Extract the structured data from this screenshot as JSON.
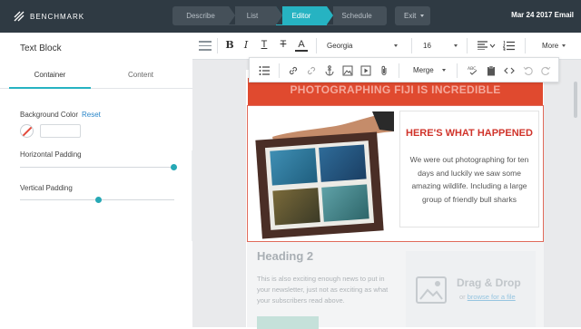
{
  "topbar": {
    "brand": "BENCHMARK",
    "steps": [
      "Describe",
      "List",
      "Editor",
      "Schedule"
    ],
    "active_step": "Editor",
    "exit_label": "Exit",
    "date_title": "Mar 24 2017 Email",
    "accent": "#26b3c2"
  },
  "left_panel": {
    "title": "Text Block",
    "tabs": [
      "Container",
      "Content"
    ],
    "active_tab": "Container",
    "background_color_label": "Background Color",
    "reset_label": "Reset",
    "horizontal_padding_label": "Horizontal Padding",
    "horizontal_padding_level": 1.0,
    "vertical_padding_label": "Vertical Padding",
    "vertical_padding_level": 0.5
  },
  "toolbar": {
    "bold": "B",
    "italic": "I",
    "underline": "T",
    "strike": "T",
    "font_color": "A",
    "font_family": "Georgia",
    "font_size": "16",
    "more_label": "More",
    "merge_label": "Merge"
  },
  "email": {
    "banner": "PHOTOGRAPHING FIJI IS INCREDIBLE",
    "banner_color": "#e04a2f",
    "heres_title": "HERE'S WHAT HAPPENED",
    "heres_body": "We were out photographing for ten days and luckily we saw some amazing wildlife. Including a large group of friendly bull sharks",
    "heading2": "Heading 2",
    "lower_body": "This is also exciting enough news to put in your newsletter, just not as exciting as what your subscribers read above.",
    "dnd_title": "Drag & Drop",
    "dnd_or": "or",
    "dnd_link": "browse for a file"
  }
}
